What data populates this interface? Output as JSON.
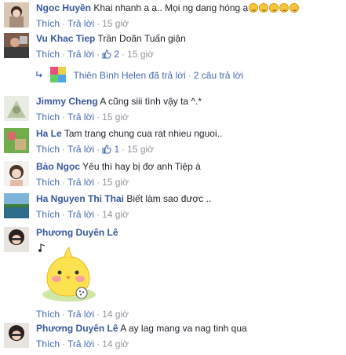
{
  "colors": {
    "link": "#365899",
    "action": "#4267b2",
    "meta": "#90949c",
    "text": "#1d2129"
  },
  "action_like": "Thích",
  "action_reply": "Trả lời",
  "comments": [
    {
      "author": "Ngoc Huyền",
      "text": "Khai nhanh a ạ.. Mọi ng dang hóng ạ",
      "emojis": [
        "smiley-face",
        "smiley-face",
        "smiley-face",
        "smiley-face",
        "smiley-face"
      ],
      "time": "15 giờ",
      "likes": ""
    },
    {
      "author": "Vu Khac Tiep",
      "text": "Trần Doãn Tuấn giận",
      "time": "15 giờ",
      "likes": "2"
    },
    {
      "author": "Jimmy Cheng",
      "text": "A cũng siii tình vậy ta ^.*",
      "time": "15 giờ",
      "likes": ""
    },
    {
      "author": "Ha Le",
      "text": "Tam trang chung cua rat nhieu nguoi..",
      "time": "15 giờ",
      "likes": "1"
    },
    {
      "author": "Bảo Ngọc",
      "text": "Yêu thì hay bị đơ anh Tiệp à",
      "time": "15 giờ",
      "likes": ""
    },
    {
      "author": "Ha Nguyen Thi Thai",
      "text": "Biết làm sao được ..",
      "time": "14 giờ",
      "likes": ""
    },
    {
      "author": "Phương Duyên Lê",
      "text": "",
      "sticker": "yellow-chick-sticker",
      "time": "14 giờ",
      "likes": ""
    },
    {
      "author": "Phương Duyên Lê",
      "text": "A ay lag mang va nag tinh qua",
      "time": "14 giờ",
      "likes": ""
    }
  ],
  "reply_summary": {
    "name": "Thiên Bình Helen",
    "text": "đã trả lời",
    "count": "2 câu trả lời"
  }
}
